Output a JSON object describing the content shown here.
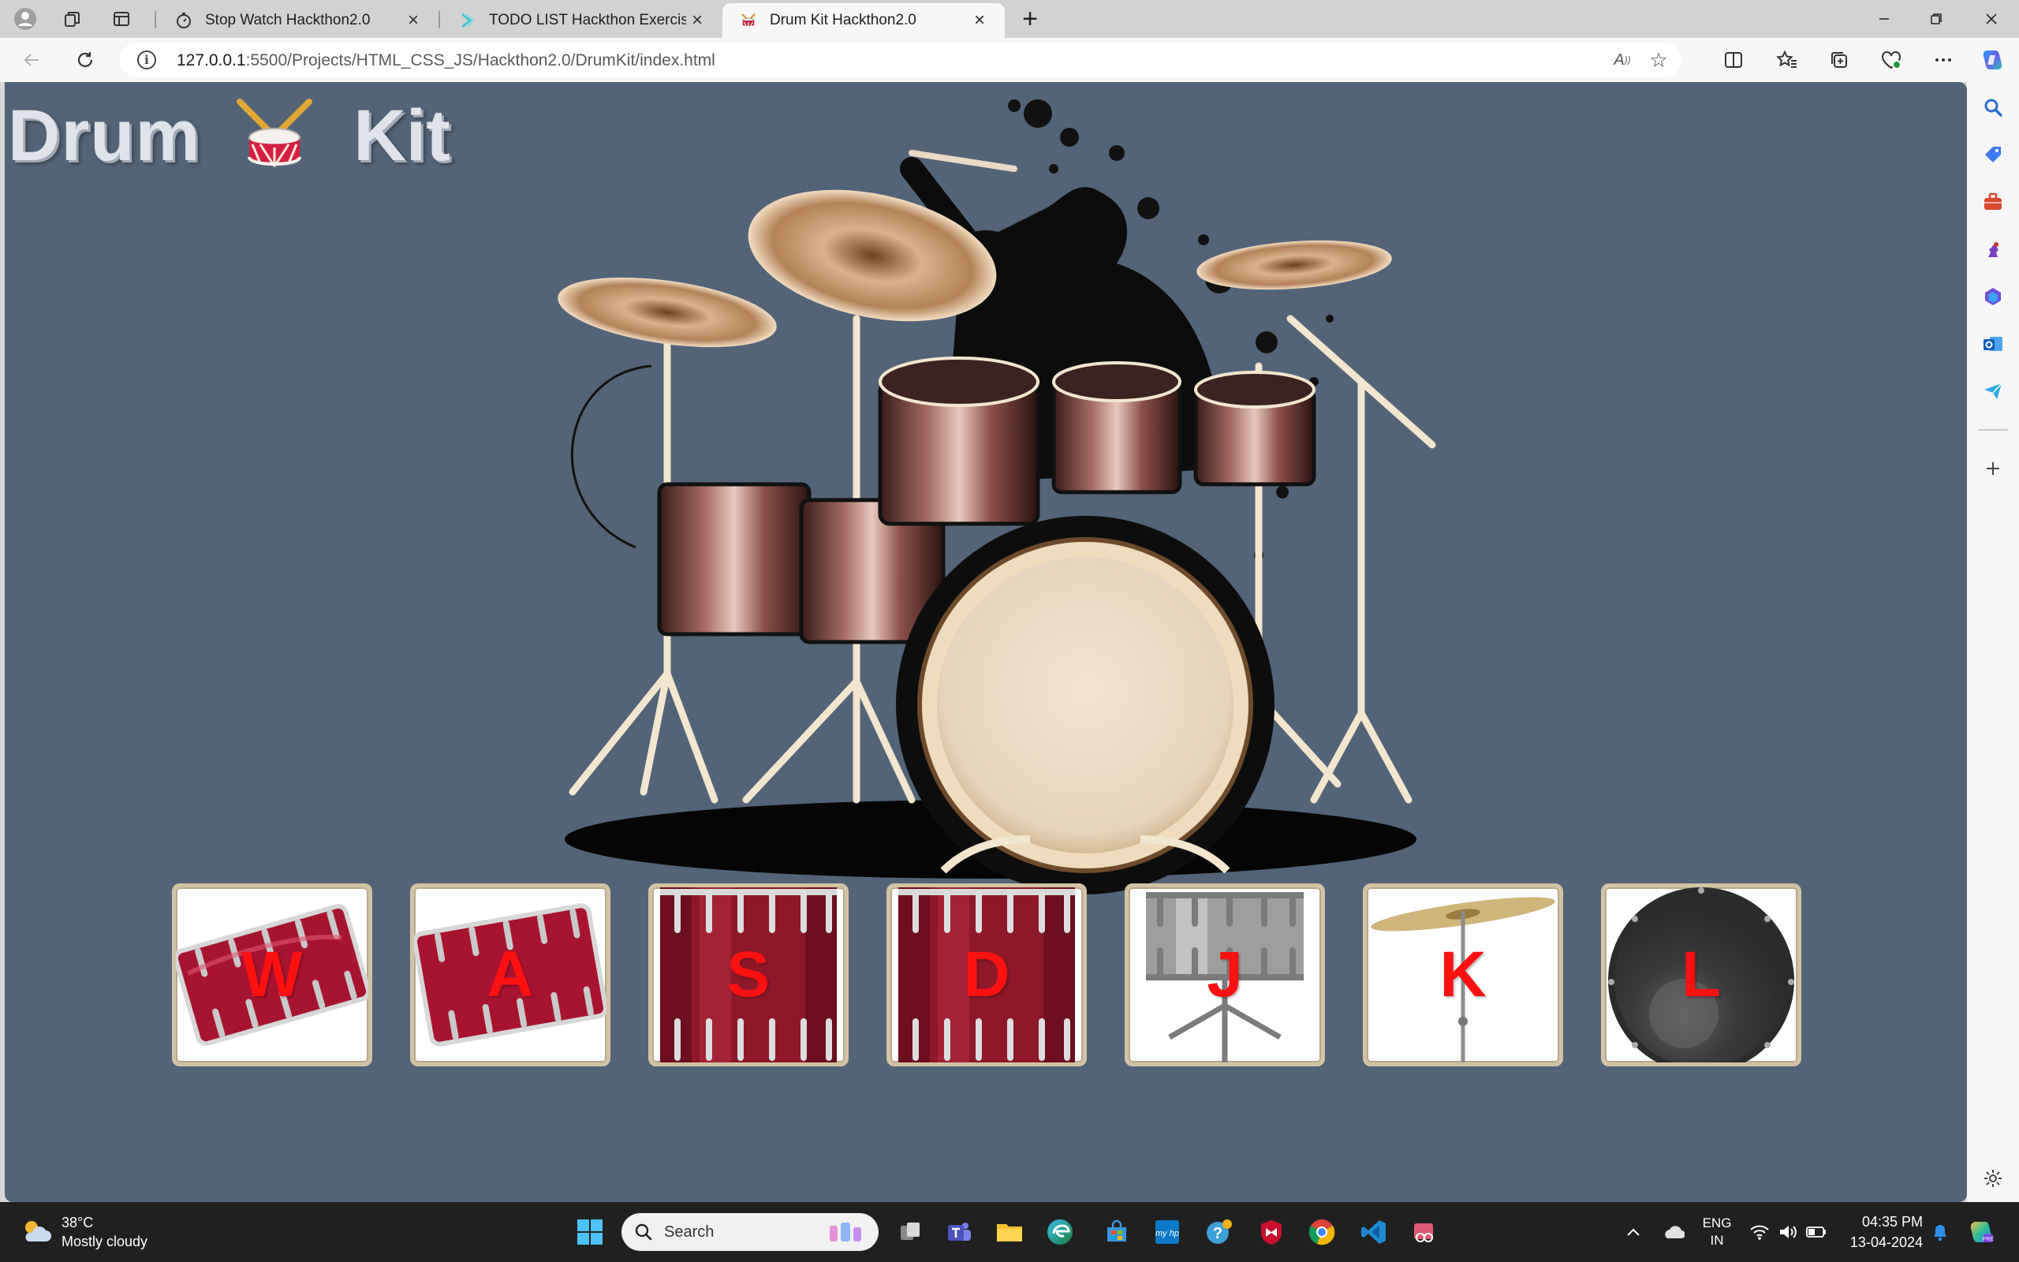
{
  "browser": {
    "tabs": [
      {
        "title": "Stop Watch Hackthon2.0",
        "active": false
      },
      {
        "title": "TODO LIST Hackthon Exercise",
        "active": false
      },
      {
        "title": "Drum Kit Hackthon2.0",
        "active": true
      }
    ],
    "url_host": "127.0.0.1",
    "url_path": ":5500/Projects/HTML_CSS_JS/Hackthon2.0/DrumKit/index.html"
  },
  "page": {
    "title_left": "Drum",
    "title_right": "Kit",
    "drums": [
      {
        "key": "W",
        "kind": "tom-tilt-1"
      },
      {
        "key": "A",
        "kind": "tom-tilt-2"
      },
      {
        "key": "S",
        "kind": "snare"
      },
      {
        "key": "D",
        "kind": "snare"
      },
      {
        "key": "J",
        "kind": "hihat-stand"
      },
      {
        "key": "K",
        "kind": "cymbal"
      },
      {
        "key": "L",
        "kind": "kick"
      }
    ]
  },
  "taskbar": {
    "temperature": "38°C",
    "condition": "Mostly cloudy",
    "search_placeholder": "Search",
    "lang_top": "ENG",
    "lang_bottom": "IN",
    "time": "04:35 PM",
    "date": "13-04-2024"
  }
}
